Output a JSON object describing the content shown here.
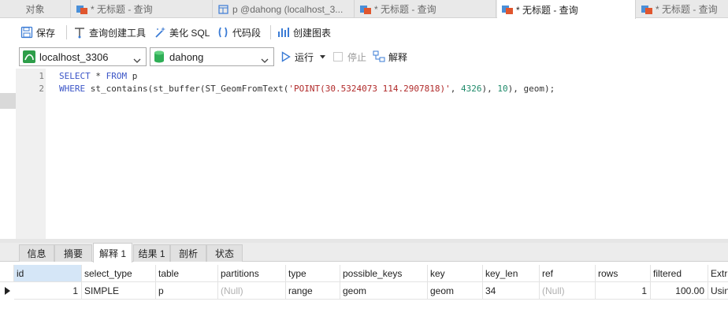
{
  "tabs": [
    {
      "label": "对象",
      "icon": "none"
    },
    {
      "label": "* 无标题 - 查询",
      "icon": "query-icon"
    },
    {
      "label": "p @dahong (localhost_3...",
      "icon": "table-icon"
    },
    {
      "label": "* 无标题 - 查询",
      "icon": "query-icon"
    },
    {
      "label": "* 无标题 - 查询",
      "icon": "query-icon",
      "active": true
    },
    {
      "label": "* 无标题 - 查询",
      "icon": "query-icon"
    }
  ],
  "toolbar": {
    "save": "保存",
    "query_builder": "查询创建工具",
    "beautify": "美化 SQL",
    "snippet": "代码段",
    "create_chart": "创建图表"
  },
  "connbar": {
    "connection": "localhost_3306",
    "database": "dahong",
    "run": "运行",
    "stop": "停止",
    "explain": "解释"
  },
  "editor": {
    "line_numbers": [
      "1",
      "2"
    ],
    "line1": {
      "kw1": "SELECT",
      "rest1": " * ",
      "kw2": "FROM",
      "rest2": " p"
    },
    "line2": {
      "kw1": "WHERE",
      "t1": " st_contains(st_buffer(ST_GeomFromText(",
      "s1": "'POINT(30.5324073 114.2907818)'",
      "t2": ", ",
      "n1": "4326",
      "t3": "), ",
      "n2": "10",
      "t4": "), geom);"
    }
  },
  "bottom_tabs": [
    {
      "label": "信息"
    },
    {
      "label": "摘要"
    },
    {
      "label": "解释 1",
      "active": true
    },
    {
      "label": "结果 1"
    },
    {
      "label": "剖析"
    },
    {
      "label": "状态"
    }
  ],
  "grid": {
    "headers": [
      "id",
      "select_type",
      "table",
      "partitions",
      "type",
      "possible_keys",
      "key",
      "key_len",
      "ref",
      "rows",
      "filtered",
      "Extra"
    ],
    "row": [
      "1",
      "SIMPLE",
      "p",
      "(Null)",
      "range",
      "geom",
      "geom",
      "34",
      "(Null)",
      "1",
      "100.00",
      "Using"
    ]
  },
  "colors": {
    "keyword": "#3b55c7",
    "string": "#b02a2a",
    "number": "#1e8a6a",
    "null_text": "#b0b0b0"
  }
}
